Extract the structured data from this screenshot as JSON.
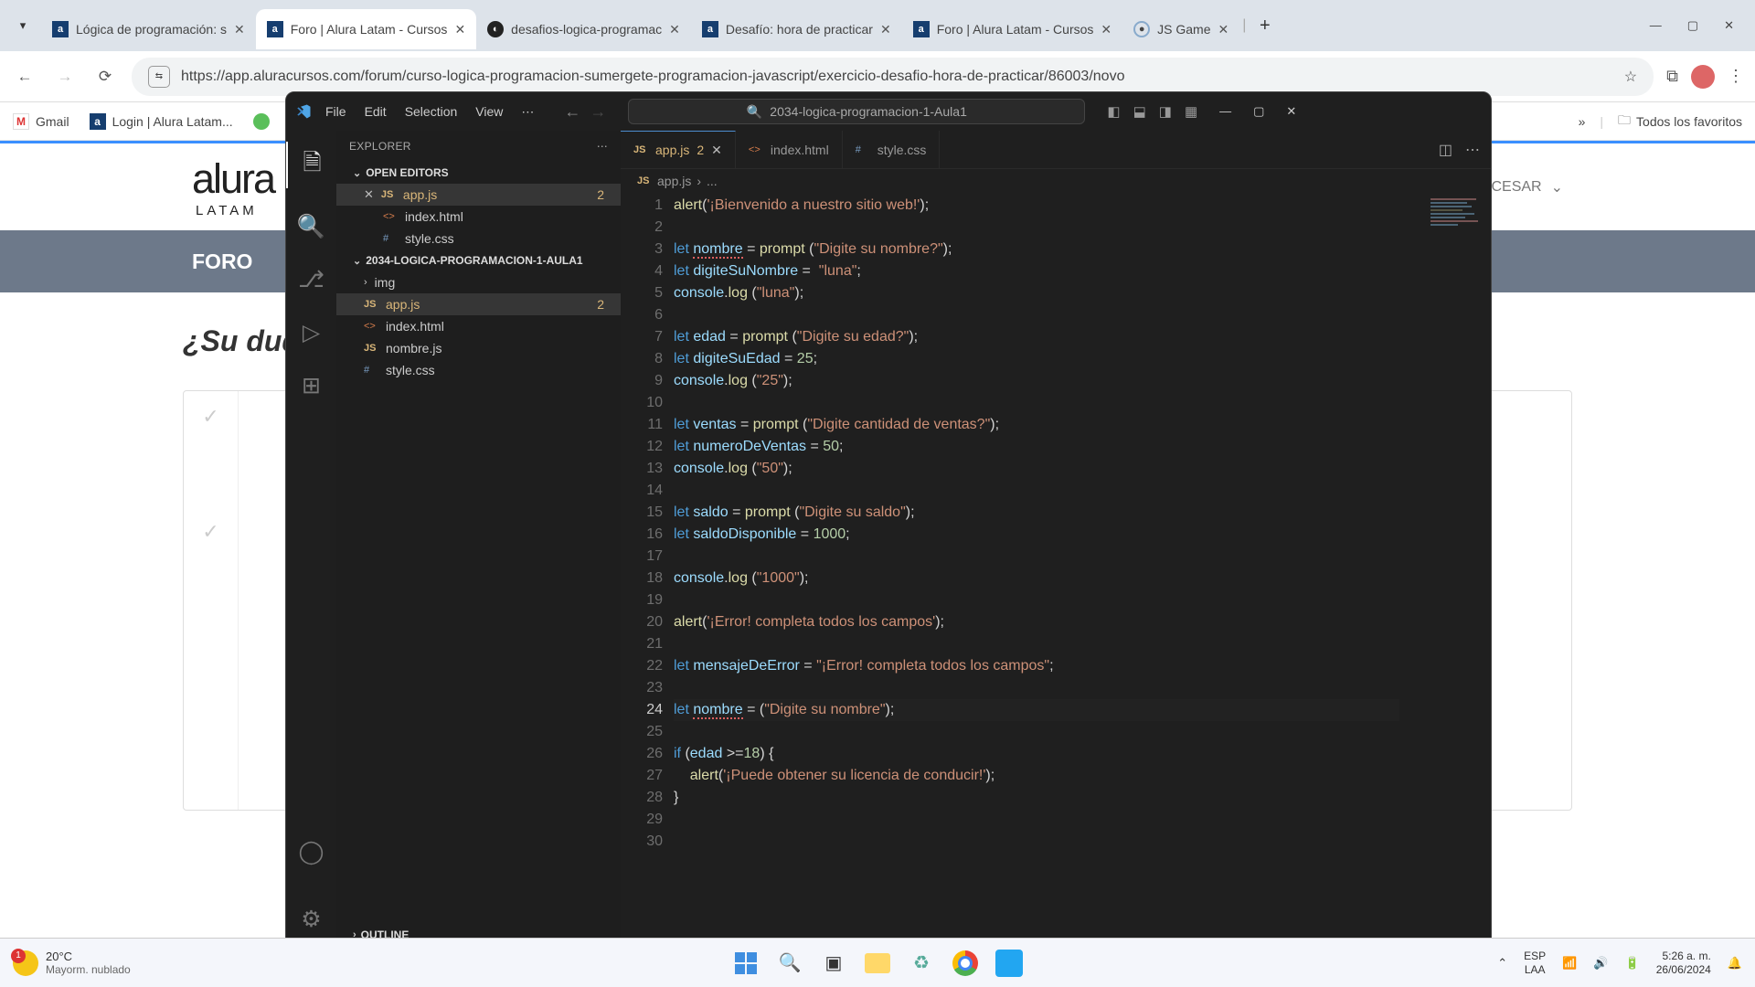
{
  "browser": {
    "tabs": [
      {
        "title": "Lógica de programación: s",
        "icon": "a"
      },
      {
        "title": "Foro | Alura Latam - Cursos",
        "icon": "a",
        "active": true
      },
      {
        "title": "desafios-logica-programac",
        "icon": "gh"
      },
      {
        "title": "Desafío: hora de practicar",
        "icon": "a"
      },
      {
        "title": "Foro | Alura Latam - Cursos",
        "icon": "a"
      },
      {
        "title": "JS Game",
        "icon": "js"
      }
    ],
    "url": "https://app.aluracursos.com/forum/curso-logica-programacion-sumergete-programacion-javascript/exercicio-desafio-hora-de-practicar/86003/novo",
    "bookmarks": [
      {
        "label": "Gmail",
        "icon": "M"
      },
      {
        "label": "Login | Alura Latam...",
        "icon": "a"
      }
    ],
    "more_bookmarks": "»",
    "all_fav": "Todos los favoritos"
  },
  "page": {
    "logo_main": "alura",
    "logo_sub": "LATAM",
    "user": "CESAR",
    "foro": "FORO",
    "question": "¿Su duda"
  },
  "vscode": {
    "menu": [
      "File",
      "Edit",
      "Selection",
      "View"
    ],
    "more": "⋯",
    "search_label": "2034-logica-programacion-1-Aula1",
    "explorer": "EXPLORER",
    "open_editors": "OPEN EDITORS",
    "project": "2034-LOGICA-PROGRAMACION-1-AULA1",
    "outline": "OUTLINE",
    "open_editor_items": [
      {
        "name": "app.js",
        "icon": "JS",
        "mod": true,
        "badge": "2",
        "close": true
      },
      {
        "name": "index.html",
        "icon": "<>"
      },
      {
        "name": "style.css",
        "icon": "#"
      }
    ],
    "project_items": [
      {
        "name": "img",
        "icon": ">",
        "folder": true
      },
      {
        "name": "app.js",
        "icon": "JS",
        "mod": true,
        "badge": "2",
        "sel": true
      },
      {
        "name": "index.html",
        "icon": "<>"
      },
      {
        "name": "nombre.js",
        "icon": "JS"
      },
      {
        "name": "style.css",
        "icon": "#"
      }
    ],
    "editor_tabs": [
      {
        "name": "app.js",
        "icon": "JS",
        "badge": "2",
        "active": true,
        "close": true
      },
      {
        "name": "index.html",
        "icon": "<>"
      },
      {
        "name": "style.css",
        "icon": "#"
      }
    ],
    "breadcrumb": [
      "app.js",
      "..."
    ],
    "code": [
      {
        "n": 1,
        "html": "<span class='fn'>alert</span><span class='punc'>(</span><span class='str'>'¡Bienvenido a nuestro sitio web!'</span><span class='punc'>);</span>"
      },
      {
        "n": 2,
        "html": ""
      },
      {
        "n": 3,
        "html": "<span class='kw'>let</span> <span class='var err-underline'>nombre</span> <span class='op'>=</span> <span class='fn'>prompt</span> <span class='punc'>(</span><span class='str'>\"Digite su nombre?\"</span><span class='punc'>);</span>"
      },
      {
        "n": 4,
        "html": "<span class='kw'>let</span> <span class='var'>digiteSuNombre</span> <span class='op'>=</span>  <span class='str'>\"luna\"</span><span class='punc'>;</span>"
      },
      {
        "n": 5,
        "html": "<span class='prop'>console</span><span class='punc'>.</span><span class='fn'>log</span> <span class='punc'>(</span><span class='str'>\"luna\"</span><span class='punc'>);</span>"
      },
      {
        "n": 6,
        "html": ""
      },
      {
        "n": 7,
        "html": "<span class='kw'>let</span> <span class='var'>edad</span> <span class='op'>=</span> <span class='fn'>prompt</span> <span class='punc'>(</span><span class='str'>\"Digite su edad?\"</span><span class='punc'>);</span>"
      },
      {
        "n": 8,
        "html": "<span class='kw'>let</span> <span class='var'>digiteSuEdad</span> <span class='op'>=</span> <span class='num'>25</span><span class='punc'>;</span>"
      },
      {
        "n": 9,
        "html": "<span class='prop'>console</span><span class='punc'>.</span><span class='fn'>log</span> <span class='punc'>(</span><span class='str'>\"25\"</span><span class='punc'>);</span>"
      },
      {
        "n": 10,
        "html": ""
      },
      {
        "n": 11,
        "html": "<span class='kw'>let</span> <span class='var'>ventas</span> <span class='op'>=</span> <span class='fn'>prompt</span> <span class='punc'>(</span><span class='str'>\"Digite cantidad de ventas?\"</span><span class='punc'>);</span>"
      },
      {
        "n": 12,
        "html": "<span class='kw'>let</span> <span class='var'>numeroDeVentas</span> <span class='op'>=</span> <span class='num'>50</span><span class='punc'>;</span>"
      },
      {
        "n": 13,
        "html": "<span class='prop'>console</span><span class='punc'>.</span><span class='fn'>log</span> <span class='punc'>(</span><span class='str'>\"50\"</span><span class='punc'>);</span>"
      },
      {
        "n": 14,
        "html": ""
      },
      {
        "n": 15,
        "html": "<span class='kw'>let</span> <span class='var'>saldo</span> <span class='op'>=</span> <span class='fn'>prompt</span> <span class='punc'>(</span><span class='str'>\"Digite su saldo\"</span><span class='punc'>);</span>"
      },
      {
        "n": 16,
        "html": "<span class='kw'>let</span> <span class='var'>saldoDisponible</span> <span class='op'>=</span> <span class='num'>1000</span><span class='punc'>;</span>"
      },
      {
        "n": 17,
        "html": ""
      },
      {
        "n": 18,
        "html": "<span class='prop'>console</span><span class='punc'>.</span><span class='fn'>log</span> <span class='punc'>(</span><span class='str'>\"1000\"</span><span class='punc'>);</span>"
      },
      {
        "n": 19,
        "html": ""
      },
      {
        "n": 20,
        "html": "<span class='fn'>alert</span><span class='punc'>(</span><span class='str'>'¡Error! completa todos los campos'</span><span class='punc'>);</span>"
      },
      {
        "n": 21,
        "html": ""
      },
      {
        "n": 22,
        "html": "<span class='kw'>let</span> <span class='var'>mensajeDeError</span> <span class='op'>=</span> <span class='str'>\"¡Error! completa todos los campos\"</span><span class='punc'>;</span>"
      },
      {
        "n": 23,
        "html": ""
      },
      {
        "n": 24,
        "html": "<span class='kw'>let</span> <span class='var err-underline'>nombre</span> <span class='op'>=</span> <span class='punc'>(</span><span class='str'>\"Digite su nombre\"</span><span class='punc'>);</span>",
        "active": true
      },
      {
        "n": 25,
        "html": ""
      },
      {
        "n": 26,
        "html": "<span class='kw'>if</span> <span class='punc'>(</span><span class='var'>edad</span> <span class='op'>&gt;=</span><span class='num'>18</span><span class='punc'>)</span> <span class='punc'>{</span>"
      },
      {
        "n": 27,
        "html": "    <span class='fn'>alert</span><span class='punc'>(</span><span class='str'>'¡Puede obtener su licencia de conducir!'</span><span class='punc'>);</span>"
      },
      {
        "n": 28,
        "html": "<span class='punc'>}</span>"
      },
      {
        "n": 29,
        "html": ""
      },
      {
        "n": 30,
        "html": ""
      }
    ]
  },
  "taskbar": {
    "temp": "20°C",
    "weather": "Mayorm. nublado",
    "lang1": "ESP",
    "lang2": "LAA",
    "time": "5:26 a. m.",
    "date": "26/06/2024"
  }
}
